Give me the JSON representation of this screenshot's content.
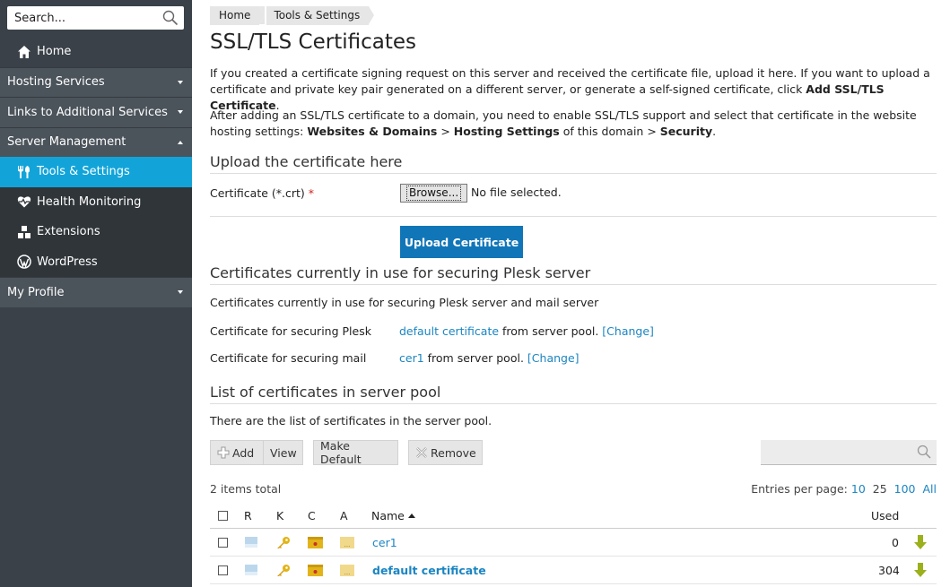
{
  "sidebar": {
    "search_placeholder": "Search...",
    "items": [
      {
        "label": "Home",
        "type": "top",
        "icon": "home-icon"
      },
      {
        "label": "Hosting Services",
        "type": "group",
        "caret": "down"
      },
      {
        "label": "Links to Additional Services",
        "type": "group",
        "caret": "down"
      },
      {
        "label": "Server Management",
        "type": "group",
        "caret": "up"
      },
      {
        "label": "Tools & Settings",
        "type": "sub",
        "icon": "tools-icon",
        "active": true
      },
      {
        "label": "Health Monitoring",
        "type": "sub",
        "icon": "heart-pulse-icon"
      },
      {
        "label": "Extensions",
        "type": "sub",
        "icon": "extensions-icon"
      },
      {
        "label": "WordPress",
        "type": "sub",
        "icon": "wordpress-icon"
      },
      {
        "label": "My Profile",
        "type": "group",
        "caret": "down"
      }
    ]
  },
  "breadcrumb": [
    "Home",
    "Tools & Settings"
  ],
  "page": {
    "title": "SSL/TLS Certificates",
    "intro1_a": "If you created a certificate signing request on this server and received the certificate file, upload it here. If you want to upload a certificate and private key pair generated on a different server, or generate a self-signed certificate, click ",
    "intro1_b": "Add SSL/TLS Certificate",
    "intro1_c": ".",
    "intro2_a": "After adding an SSL/TLS certificate to a domain, you need to enable SSL/TLS support and select that certificate in the website hosting settings: ",
    "intro2_b": "Websites & Domains",
    "intro2_c": " > ",
    "intro2_d": "Hosting Settings",
    "intro2_e": " of this domain > ",
    "intro2_f": "Security",
    "intro2_g": "."
  },
  "upload": {
    "heading": "Upload the certificate here",
    "cert_label": "Certificate (*.crt)",
    "required_mark": "*",
    "browse_label": "Browse...",
    "no_file": "No file selected.",
    "upload_button": "Upload Certificate"
  },
  "in_use": {
    "heading": "Certificates currently in use for securing Plesk server",
    "desc": "Certificates currently in use for securing Plesk server and mail server",
    "plesk_label": "Certificate for securing Plesk",
    "plesk_cert": "default certificate",
    "plesk_suffix": "from server pool.",
    "change": "[Change]",
    "mail_label": "Certificate for securing mail",
    "mail_cert": "cer1",
    "mail_suffix": "from server pool."
  },
  "pool": {
    "heading": "List of certificates in server pool",
    "desc": "There are the list of sertificates in the server pool.",
    "toolbar": {
      "add": "Add",
      "view": "View",
      "make_default": "Make Default",
      "remove": "Remove"
    },
    "items_total": "2 items total",
    "entries_label": "Entries per page:",
    "entries_options": [
      "10",
      "25",
      "100",
      "All"
    ],
    "columns": {
      "r": "R",
      "k": "K",
      "c": "C",
      "a": "A",
      "name": "Name",
      "used": "Used"
    },
    "rows": [
      {
        "name": "cer1",
        "used": "0"
      },
      {
        "name": "default certificate",
        "used": "304"
      }
    ]
  },
  "colors": {
    "sidebar_bg": "#3a4148",
    "active": "#12a4d9",
    "link": "#1b85c2",
    "primary_button": "#1176b8"
  }
}
